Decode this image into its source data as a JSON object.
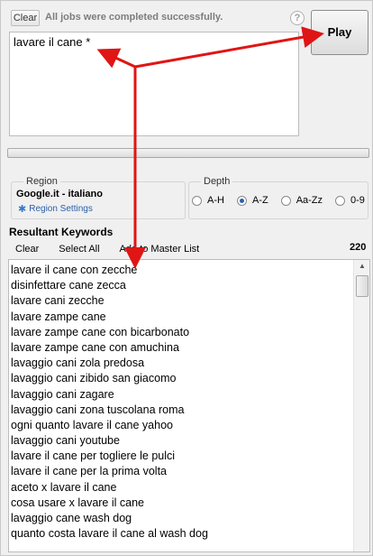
{
  "top": {
    "clear_label": "Clear",
    "status": "All jobs were completed successfully.",
    "help_glyph": "?",
    "play_label": "Play"
  },
  "seed": {
    "text": "lavare il cane *"
  },
  "progress": {
    "value": 0
  },
  "region": {
    "legend": "Region",
    "value": "Google.it - italiano",
    "settings_label": "Region Settings"
  },
  "depth": {
    "legend": "Depth",
    "options": [
      "A-H",
      "A-Z",
      "Aa-Zz",
      "0-9"
    ],
    "selected": "A-Z"
  },
  "results": {
    "title": "Resultant Keywords",
    "count": "220",
    "toolbar": {
      "clear": "Clear",
      "select_all": "Select All",
      "add_master": "Add to Master List"
    },
    "keywords": [
      "lavare il cane con zecche",
      "disinfettare cane zecca",
      "lavare cani zecche",
      "lavare zampe cane",
      "lavare zampe cane con bicarbonato",
      "lavare zampe cane con amuchina",
      "lavaggio cani zola predosa",
      "lavaggio cani zibido san giacomo",
      "lavaggio cani zagare",
      "lavaggio cani zona tuscolana roma",
      "ogni quanto lavare il cane yahoo",
      "lavaggio cani youtube",
      "lavare il cane per togliere le pulci",
      "lavare il cane per la prima volta",
      "aceto x lavare il cane",
      "cosa usare x lavare il cane",
      "lavaggio cane wash dog",
      "quanto costa lavare il cane al wash dog"
    ]
  },
  "annotation_color": "#e01515"
}
